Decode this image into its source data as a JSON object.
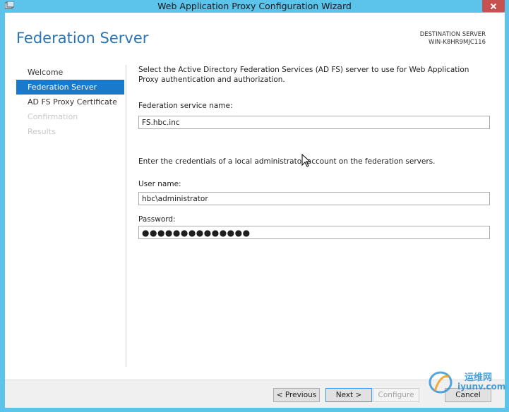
{
  "window": {
    "title": "Web Application Proxy Configuration Wizard"
  },
  "page": {
    "heading": "Federation Server",
    "destination_label": "DESTINATION SERVER",
    "destination_server": "WIN-K8HR9MJC116"
  },
  "nav": {
    "items": [
      {
        "label": "Welcome",
        "state": "normal"
      },
      {
        "label": "Federation Server",
        "state": "active"
      },
      {
        "label": "AD FS Proxy Certificate",
        "state": "normal"
      },
      {
        "label": "Confirmation",
        "state": "disabled"
      },
      {
        "label": "Results",
        "state": "disabled"
      }
    ]
  },
  "form": {
    "intro": "Select the Active Directory Federation Services (AD FS) server to use for Web Application Proxy authentication and authorization.",
    "federation_service_label": "Federation service name:",
    "federation_service_value": "FS.hbc.inc",
    "credentials_prompt": "Enter the credentials of a local administrator account on the federation servers.",
    "username_label": "User name:",
    "username_value": "hbc\\administrator",
    "password_label": "Password:",
    "password_value": "●●●●●●●●●●●●●●"
  },
  "buttons": {
    "previous": "< Previous",
    "next": "Next >",
    "configure": "Configure",
    "cancel": "Cancel"
  },
  "watermark": {
    "cn": "运维网",
    "url": "iyunv.com"
  },
  "colors": {
    "frame": "#5cc3ea",
    "accent": "#1979ca",
    "heading": "#2b74b4",
    "close": "#c75050"
  }
}
